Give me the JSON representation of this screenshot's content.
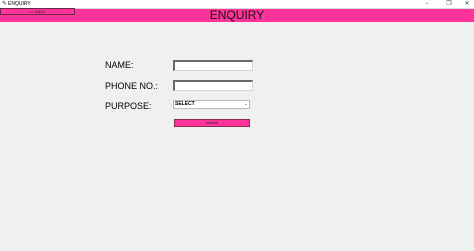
{
  "window": {
    "title": "ENQUIRY",
    "app_icon": "feather-icon",
    "controls": {
      "minimize": "–",
      "maximize": "❐",
      "close": "✕"
    }
  },
  "header": {
    "back_label": "<< BACK",
    "title": "ENQUIRY",
    "color": "#ff3399"
  },
  "form": {
    "name_label": "NAME:",
    "name_value": "",
    "phone_label": "PHONE NO.:",
    "phone_value": "",
    "purpose_label": "PURPOSE:",
    "purpose_selected": "SELECT",
    "submit_label": "submit"
  }
}
